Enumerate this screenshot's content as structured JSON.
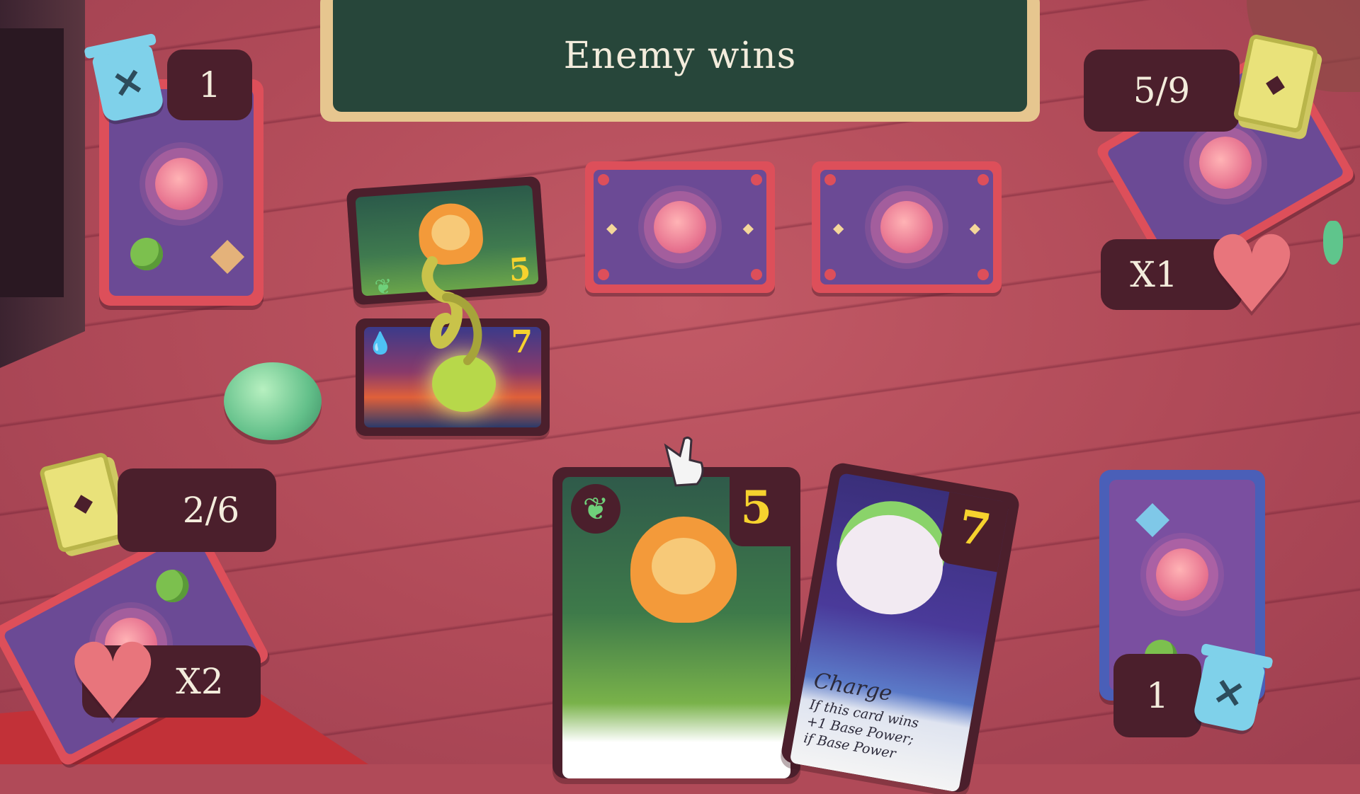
{
  "banner": {
    "text": "Enemy wins"
  },
  "player_top": {
    "discard_count": "1",
    "deck_count": "5/9",
    "lives_label": "X1"
  },
  "player_bottom": {
    "deck_count": "2/6",
    "lives_label": "X2",
    "discard_count": "1"
  },
  "board": {
    "enemy_card_power": "5",
    "player_card_power": "7"
  },
  "hand": {
    "card1": {
      "power": "5",
      "element": "leaf"
    },
    "card2": {
      "power": "7",
      "ability_title": "Charge",
      "ability_text": "If this card wins +1 Base Power; if Base Power"
    }
  },
  "colors": {
    "table": "#b04a58",
    "card_back": "#dd4f5a",
    "card_face": "#6b4a95",
    "pill": "#4b1f2c",
    "banner": "#27463a",
    "power_text": "#f6d22e"
  }
}
